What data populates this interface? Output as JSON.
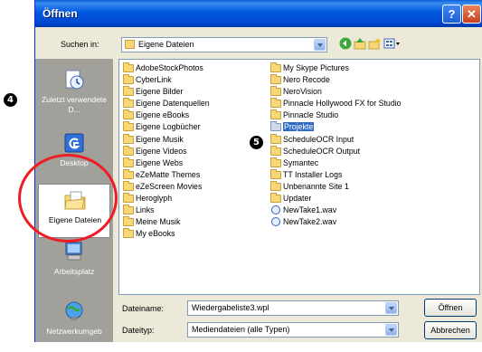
{
  "dialog": {
    "title": "Öffnen"
  },
  "lookin": {
    "label": "Suchen in:",
    "value": "Eigene Dateien"
  },
  "places": [
    {
      "label": "Zuletzt verwendete D..."
    },
    {
      "label": "Desktop"
    },
    {
      "label": "Eigene Dateien"
    },
    {
      "label": "Arbeitsplatz"
    },
    {
      "label": "Netzwerkumgeb"
    }
  ],
  "files": {
    "col1": [
      "AdobeStockPhotos",
      "CyberLink",
      "Eigene Bilder",
      "Eigene Datenquellen",
      "Eigene eBooks",
      "Eigene Logbücher",
      "Eigene Musik",
      "Eigene Videos",
      "Eigene Webs",
      "eZeMatte Themes",
      "eZeScreen Movies",
      "Heroglyph",
      "Links",
      "Meine Musik",
      "My eBooks"
    ],
    "col2": [
      "My Skype Pictures",
      "Nero Recode",
      "NeroVision",
      "Pinnacle Hollywood FX for Studio",
      "Pinnacle Studio",
      "Projekte",
      "ScheduleOCR Input",
      "ScheduleOCR Output",
      "Symantec",
      "TT Installer Logs",
      "Unbenannte Site 1",
      "Updater"
    ],
    "col2_files": [
      "NewTake1.wav",
      "NewTake2.wav"
    ]
  },
  "filename": {
    "label": "Dateiname:",
    "value": "Wiedergabeliste3.wpl"
  },
  "filetype": {
    "label": "Dateityp:",
    "value": "Mediendateien (alle Typen)"
  },
  "buttons": {
    "open": "Öffnen",
    "cancel": "Abbrechen"
  },
  "markers": {
    "four": "4",
    "five": "5"
  },
  "colors": {
    "title_bar": "#0058e0",
    "places_bar": "#a2a09a",
    "highlight_circle": "#ee1c24",
    "selection": "#316ac5"
  }
}
